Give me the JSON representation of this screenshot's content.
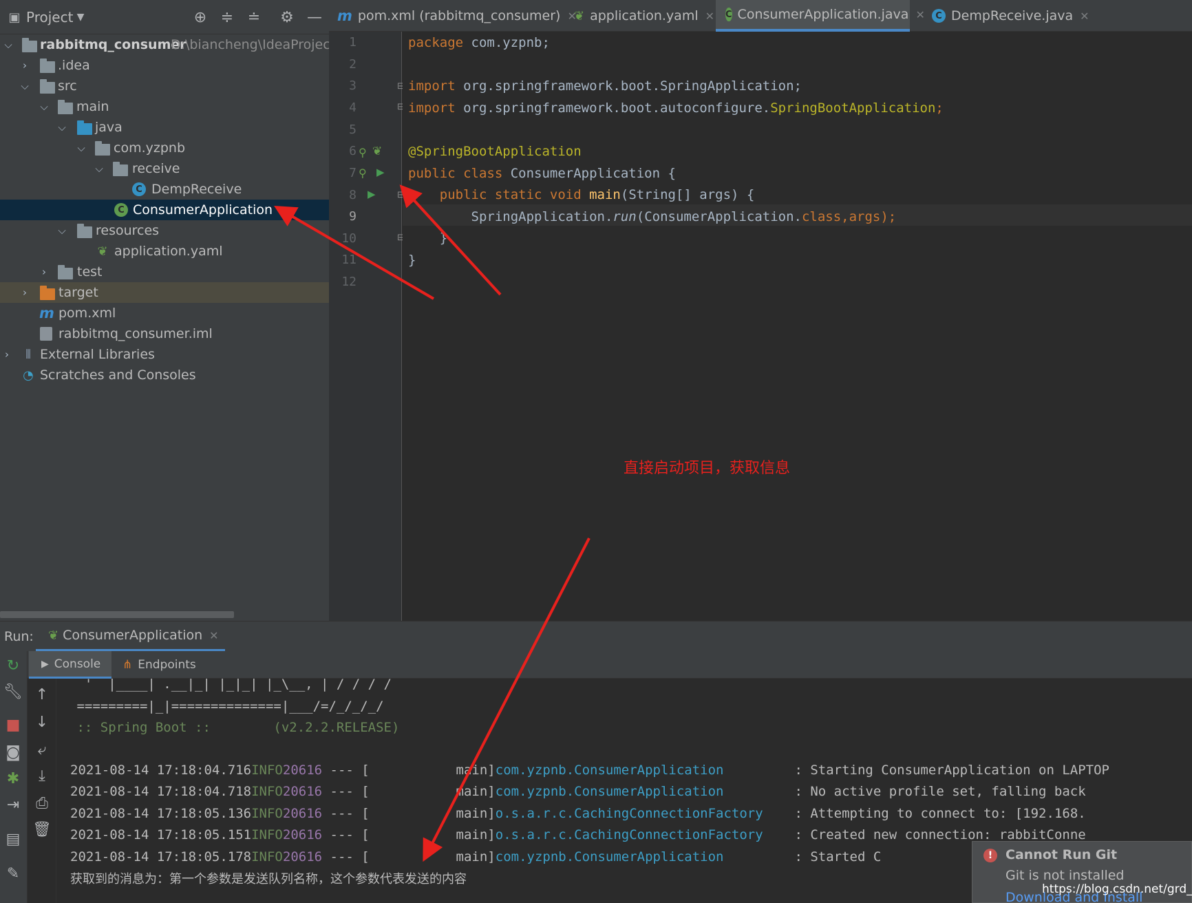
{
  "project_panel": {
    "title": "Project",
    "tree": [
      {
        "label": "rabbitmq_consumer",
        "path": "D:\\biancheng\\IdeaProjects"
      },
      {
        "label": ".idea"
      },
      {
        "label": "src"
      },
      {
        "label": "main"
      },
      {
        "label": "java"
      },
      {
        "label": "com.yzpnb"
      },
      {
        "label": "receive"
      },
      {
        "label": "DempReceive"
      },
      {
        "label": "ConsumerApplication"
      },
      {
        "label": "resources"
      },
      {
        "label": "application.yaml"
      },
      {
        "label": "test"
      },
      {
        "label": "target"
      },
      {
        "label": "pom.xml"
      },
      {
        "label": "rabbitmq_consumer.iml"
      },
      {
        "label": "External Libraries"
      },
      {
        "label": "Scratches and Consoles"
      }
    ]
  },
  "tabs": [
    {
      "label": "pom.xml (rabbitmq_consumer)"
    },
    {
      "label": "application.yaml"
    },
    {
      "label": "ConsumerApplication.java"
    },
    {
      "label": "DempReceive.java"
    }
  ],
  "editor": {
    "line_numbers": [
      "1",
      "2",
      "3",
      "4",
      "5",
      "6",
      "7",
      "8",
      "9",
      "10",
      "11",
      "12"
    ],
    "lines": {
      "l1a": "package",
      "l1b": " com.yzpnb;",
      "l3a": "import",
      "l3b": " org.springframework.boot.SpringApplication;",
      "l4a": "import",
      "l4b": " org.springframework.boot.autoconfigure.",
      "l4c": "SpringBootApplication",
      "l4d": ";",
      "l6": "@SpringBootApplication",
      "l7a": "public class",
      "l7b": " ConsumerApplication {",
      "l8a": "    public static void",
      "l8b": " main",
      "l8c": "(String[] args) {",
      "l9a": "        SpringApplication.",
      "l9b": "run",
      "l9c": "(ConsumerApplication.",
      "l9d": "class",
      "l9e": ",args);",
      "l10": "    }",
      "l11": "}"
    }
  },
  "run_panel": {
    "label": "Run:",
    "tab": "ConsumerApplication",
    "subtabs": [
      "Console",
      "Endpoints"
    ],
    "banner": [
      "  '  |____| .__|_| |_|_| |_\\__, | / / / /",
      " =========|_|==============|___/=/_/_/_/",
      " :: Spring Boot ::        (v2.2.2.RELEASE)"
    ],
    "logs": [
      {
        "ts": "2021-08-14 17:18:04.716",
        "level": "INFO",
        "pid": "20616",
        "sep": " --- [",
        "thread": "           main]",
        "logger": "com.yzpnb.ConsumerApplication",
        "pad": "         ",
        "msg": ": Starting ConsumerApplication on LAPTOP"
      },
      {
        "ts": "2021-08-14 17:18:04.718",
        "level": "INFO",
        "pid": "20616",
        "sep": " --- [",
        "thread": "           main]",
        "logger": "com.yzpnb.ConsumerApplication",
        "pad": "         ",
        "msg": ": No active profile set, falling back"
      },
      {
        "ts": "2021-08-14 17:18:05.136",
        "level": "INFO",
        "pid": "20616",
        "sep": " --- [",
        "thread": "           main]",
        "logger": "o.s.a.r.c.CachingConnectionFactory",
        "pad": "    ",
        "msg": ": Attempting to connect to: [192.168."
      },
      {
        "ts": "2021-08-14 17:18:05.151",
        "level": "INFO",
        "pid": "20616",
        "sep": " --- [",
        "thread": "           main]",
        "logger": "o.s.a.r.c.CachingConnectionFactory",
        "pad": "    ",
        "msg": ": Created new connection: rabbitConne"
      },
      {
        "ts": "2021-08-14 17:18:05.178",
        "level": "INFO",
        "pid": "20616",
        "sep": " --- [",
        "thread": "           main]",
        "logger": "com.yzpnb.ConsumerApplication",
        "pad": "         ",
        "msg": ": Started C"
      }
    ],
    "message": "获取到的消息为：第一个参数是发送队列名称，这个参数代表发送的内容"
  },
  "notification": {
    "title": "Cannot Run Git",
    "body": "Git is not installed",
    "link": "Download and Install"
  },
  "annotation": {
    "text": "直接启动项目，获取信息",
    "color": "#e8211d"
  },
  "watermark": "https://blog.csdn.net/grd_java"
}
